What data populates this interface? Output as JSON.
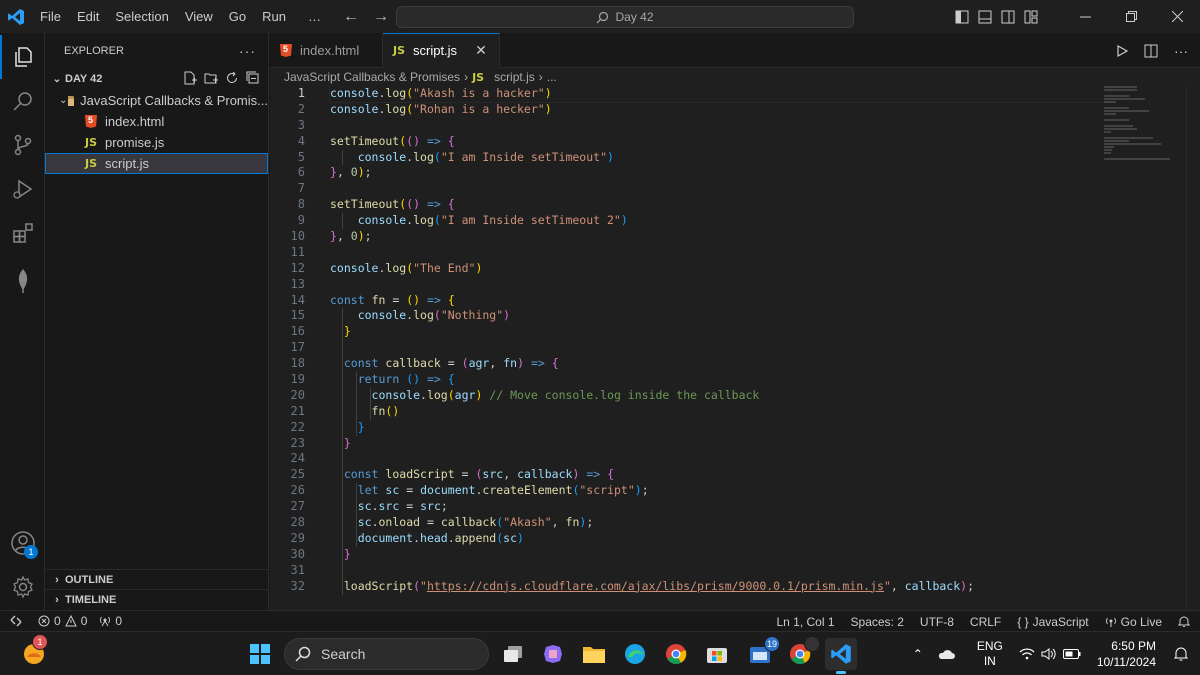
{
  "titlebar": {
    "menu": [
      "File",
      "Edit",
      "Selection",
      "View",
      "Go",
      "Run",
      "…"
    ],
    "command_center": "Day 42",
    "accent": "#0078d4"
  },
  "activity_bar": {
    "items": [
      "explorer-icon",
      "search-icon",
      "source-control-icon",
      "run-debug-icon",
      "extensions-icon",
      "mongodb-icon"
    ],
    "accounts_badge": "1"
  },
  "sidebar": {
    "title": "EXPLORER",
    "folder": "DAY 42",
    "subfolder": "JavaScript Callbacks & Promis...",
    "files": [
      {
        "name": "index.html",
        "icon": "html-icon"
      },
      {
        "name": "promise.js",
        "icon": "js-icon"
      },
      {
        "name": "script.js",
        "icon": "js-icon"
      }
    ],
    "outline": "OUTLINE",
    "timeline": "TIMELINE"
  },
  "tabs": [
    {
      "label": "index.html",
      "icon": "html-icon"
    },
    {
      "label": "script.js",
      "icon": "js-icon"
    }
  ],
  "breadcrumb": {
    "folder": "JavaScript Callbacks & Promises",
    "file": "script.js",
    "tail": "..."
  },
  "editor": {
    "line_numbers": [
      "1",
      "2",
      "3",
      "4",
      "5",
      "6",
      "7",
      "8",
      "9",
      "10",
      "11",
      "12",
      "13",
      "14",
      "15",
      "16",
      "17",
      "18",
      "19",
      "20",
      "21",
      "22",
      "23",
      "24",
      "25",
      "26",
      "27",
      "28",
      "29",
      "30",
      "31",
      "32"
    ],
    "current_line": "1"
  },
  "statusbar": {
    "problems_errors": "0",
    "problems_warnings": "0",
    "ports": "0",
    "position": "Ln 1, Col 1",
    "spaces": "Spaces: 2",
    "encoding": "UTF-8",
    "eol": "CRLF",
    "language": "JavaScript",
    "golive": "Go Live"
  },
  "taskbar": {
    "search": "Search",
    "store_badge": "19",
    "weather_badge": "1",
    "lang_line1": "ENG",
    "lang_line2": "IN",
    "time": "6:50 PM",
    "date": "10/11/2024"
  }
}
